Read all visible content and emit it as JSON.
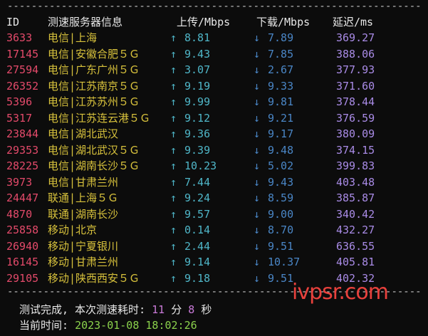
{
  "headers": {
    "id": "ID",
    "server": "测速服务器信息",
    "upload": "上传/Mbps",
    "download": "下载/Mbps",
    "latency": "延迟/ms"
  },
  "divider": "------------------------------------------------------------------------",
  "up_arrow": "↑",
  "down_arrow": "↓",
  "rows": [
    {
      "id": "3633",
      "isp": "电信",
      "loc": "上海",
      "up": "8.81",
      "down": "7.89",
      "lat": "369.27"
    },
    {
      "id": "17145",
      "isp": "电信",
      "loc": "安徽合肥５Ｇ",
      "up": "9.43",
      "down": "7.85",
      "lat": "388.06"
    },
    {
      "id": "27594",
      "isp": "电信",
      "loc": "广东广州５Ｇ",
      "up": "3.07",
      "down": "2.67",
      "lat": "377.93"
    },
    {
      "id": "26352",
      "isp": "电信",
      "loc": "江苏南京５Ｇ",
      "up": "9.19",
      "down": "9.33",
      "lat": "371.60"
    },
    {
      "id": "5396",
      "isp": "电信",
      "loc": "江苏苏州５Ｇ",
      "up": "9.99",
      "down": "9.81",
      "lat": "378.44"
    },
    {
      "id": "5317",
      "isp": "电信",
      "loc": "江苏连云港５Ｇ",
      "up": "9.12",
      "down": "9.21",
      "lat": "376.59"
    },
    {
      "id": "23844",
      "isp": "电信",
      "loc": "湖北武汉",
      "up": "9.36",
      "down": "9.17",
      "lat": "380.09"
    },
    {
      "id": "29353",
      "isp": "电信",
      "loc": "湖北武汉５Ｇ",
      "up": "9.39",
      "down": "9.48",
      "lat": "374.15"
    },
    {
      "id": "28225",
      "isp": "电信",
      "loc": "湖南长沙５Ｇ",
      "up": "10.23",
      "down": "5.02",
      "lat": "399.83"
    },
    {
      "id": "3973",
      "isp": "电信",
      "loc": "甘肃兰州",
      "up": "7.44",
      "down": "9.43",
      "lat": "403.48"
    },
    {
      "id": "24447",
      "isp": "联通",
      "loc": "上海５Ｇ",
      "up": "9.24",
      "down": "8.59",
      "lat": "385.87"
    },
    {
      "id": "4870",
      "isp": "联通",
      "loc": "湖南长沙",
      "up": "9.57",
      "down": "9.00",
      "lat": "340.42"
    },
    {
      "id": "25858",
      "isp": "移动",
      "loc": "北京",
      "up": "0.14",
      "down": "8.70",
      "lat": "432.27"
    },
    {
      "id": "26940",
      "isp": "移动",
      "loc": "宁夏银川",
      "up": "2.44",
      "down": "9.51",
      "lat": "636.55"
    },
    {
      "id": "16145",
      "isp": "移动",
      "loc": "甘肃兰州",
      "up": "9.14",
      "down": "10.37",
      "lat": "405.81"
    },
    {
      "id": "29105",
      "isp": "移动",
      "loc": "陕西西安５Ｇ",
      "up": "9.18",
      "down": "9.51",
      "lat": "402.32"
    }
  ],
  "summary": {
    "done_label": "测试完成, 本次测速耗时:",
    "minutes": "11",
    "minutes_unit": "分",
    "seconds": "8",
    "seconds_unit": "秒",
    "time_label": "当前时间:",
    "time_value": "2023-01-08 18:02:26"
  },
  "watermark": "ivpsr.com",
  "colors": {
    "background": "#0c0c0c",
    "id": "#e34a6a",
    "server": "#d8c23c",
    "upload": "#4fb6c8",
    "download": "#4a86c6",
    "latency": "#a98be6",
    "time": "#8bd24c",
    "watermark": "#e8413c"
  }
}
